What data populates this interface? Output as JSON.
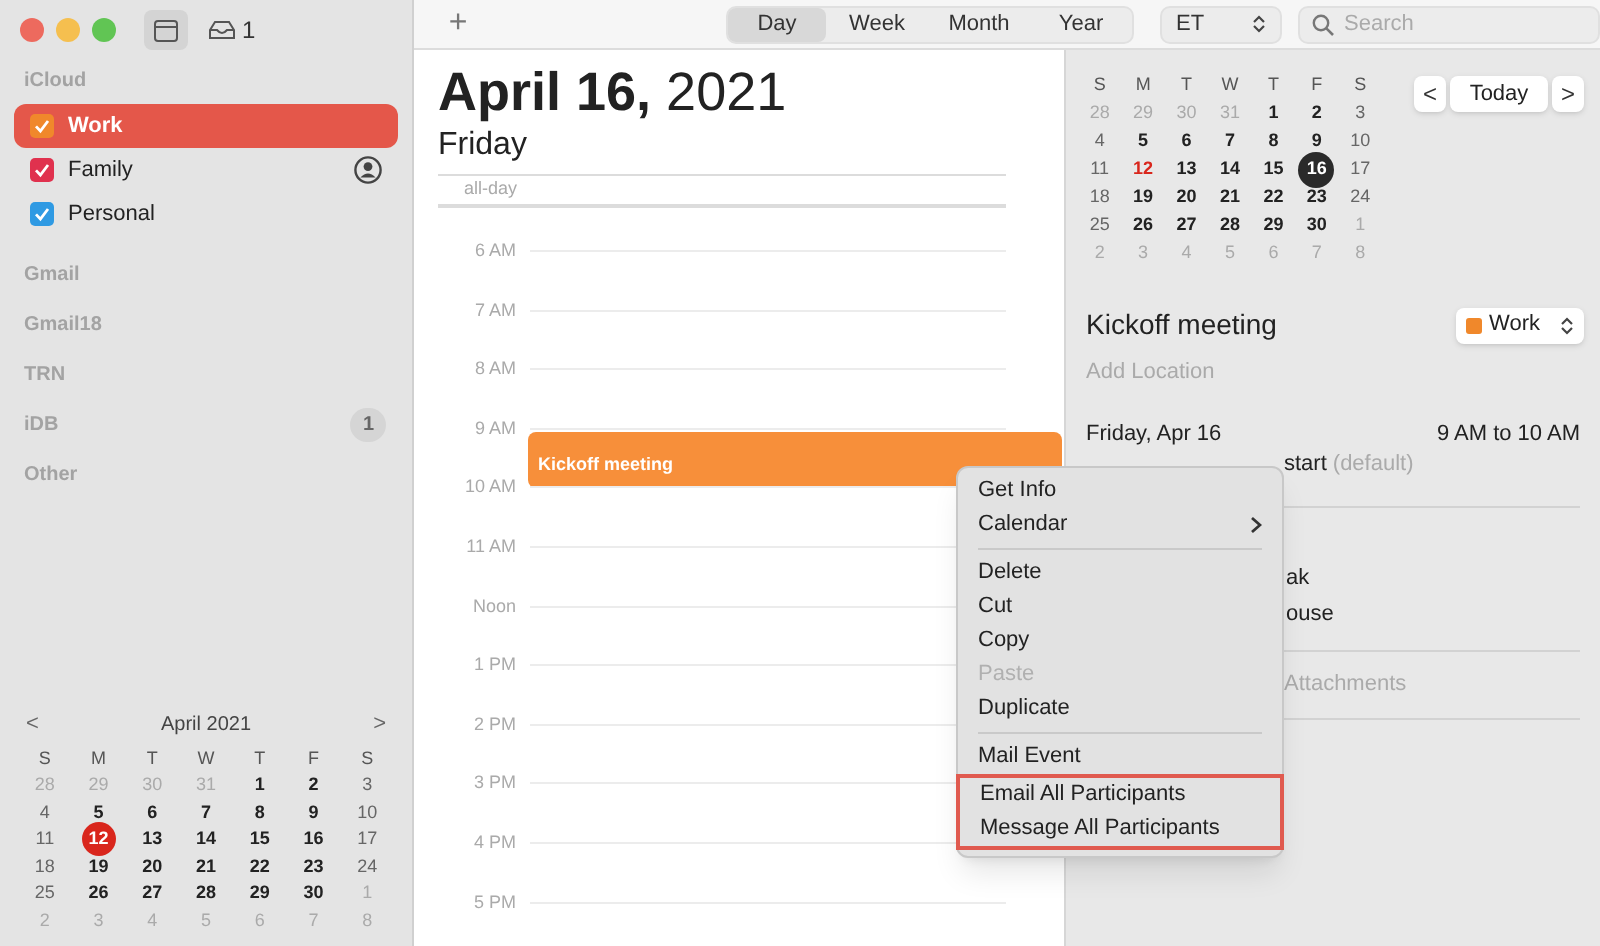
{
  "toolbar": {
    "inbox_count": "1",
    "add": "+",
    "view_tabs": [
      {
        "label": "Day",
        "selected": true
      },
      {
        "label": "Week",
        "selected": false
      },
      {
        "label": "Month",
        "selected": false
      },
      {
        "label": "Year",
        "selected": false
      }
    ],
    "timezone": "ET",
    "search": {
      "placeholder": "Search"
    }
  },
  "sidebar": {
    "accounts": [
      {
        "name": "iCloud",
        "calendars": [
          {
            "name": "Work",
            "color": "#f0882b",
            "checked": true,
            "selected": true,
            "shared": false
          },
          {
            "name": "Family",
            "color": "#e0314e",
            "checked": true,
            "selected": false,
            "shared": true
          },
          {
            "name": "Personal",
            "color": "#2f9ae3",
            "checked": true,
            "selected": false,
            "shared": false
          }
        ]
      },
      {
        "name": "Gmail"
      },
      {
        "name": "Gmail18"
      },
      {
        "name": "TRN"
      },
      {
        "name": "iDB",
        "badge": "1"
      },
      {
        "name": "Other"
      }
    ],
    "mini_calendar": {
      "prev": "<",
      "title": "April 2021",
      "next": ">",
      "weekdays": [
        "S",
        "M",
        "T",
        "W",
        "T",
        "F",
        "S"
      ],
      "weeks": [
        [
          {
            "day": "28",
            "kind": "other"
          },
          {
            "day": "29",
            "kind": "other"
          },
          {
            "day": "30",
            "kind": "other"
          },
          {
            "day": "31",
            "kind": "other"
          },
          {
            "day": "1",
            "kind": "day"
          },
          {
            "day": "2",
            "kind": "day"
          },
          {
            "day": "3",
            "kind": "weekend"
          }
        ],
        [
          {
            "day": "4",
            "kind": "weekend"
          },
          {
            "day": "5",
            "kind": "day"
          },
          {
            "day": "6",
            "kind": "day"
          },
          {
            "day": "7",
            "kind": "day"
          },
          {
            "day": "8",
            "kind": "day"
          },
          {
            "day": "9",
            "kind": "day"
          },
          {
            "day": "10",
            "kind": "weekend"
          }
        ],
        [
          {
            "day": "11",
            "kind": "weekend"
          },
          {
            "day": "12",
            "kind": "today"
          },
          {
            "day": "13",
            "kind": "day"
          },
          {
            "day": "14",
            "kind": "day"
          },
          {
            "day": "15",
            "kind": "day"
          },
          {
            "day": "16",
            "kind": "day"
          },
          {
            "day": "17",
            "kind": "weekend"
          }
        ],
        [
          {
            "day": "18",
            "kind": "weekend"
          },
          {
            "day": "19",
            "kind": "day"
          },
          {
            "day": "20",
            "kind": "day"
          },
          {
            "day": "21",
            "kind": "day"
          },
          {
            "day": "22",
            "kind": "day"
          },
          {
            "day": "23",
            "kind": "day"
          },
          {
            "day": "24",
            "kind": "weekend"
          }
        ],
        [
          {
            "day": "25",
            "kind": "weekend"
          },
          {
            "day": "26",
            "kind": "day"
          },
          {
            "day": "27",
            "kind": "day"
          },
          {
            "day": "28",
            "kind": "day"
          },
          {
            "day": "29",
            "kind": "day"
          },
          {
            "day": "30",
            "kind": "day"
          },
          {
            "day": "1",
            "kind": "other"
          }
        ],
        [
          {
            "day": "2",
            "kind": "other"
          },
          {
            "day": "3",
            "kind": "other"
          },
          {
            "day": "4",
            "kind": "other"
          },
          {
            "day": "5",
            "kind": "other"
          },
          {
            "day": "6",
            "kind": "other"
          },
          {
            "day": "7",
            "kind": "other"
          },
          {
            "day": "8",
            "kind": "other"
          }
        ]
      ]
    }
  },
  "day_view": {
    "title": "**April 16,** 2021",
    "weekday": "Friday",
    "all_day": "all-day",
    "hours": [
      {
        "label": "6 AM"
      },
      {
        "label": "7 AM"
      },
      {
        "label": "8 AM"
      },
      {
        "label": "9 AM",
        "event": "Kickoff meeting"
      },
      {
        "label": "10 AM"
      },
      {
        "label": "11 AM"
      },
      {
        "label": "Noon"
      },
      {
        "label": "1 PM"
      },
      {
        "label": "2 PM"
      },
      {
        "label": "3 PM"
      },
      {
        "label": "4 PM"
      },
      {
        "label": "5 PM"
      }
    ]
  },
  "inspector": {
    "calendar": {
      "weekdays": [
        "S",
        "M",
        "T",
        "W",
        "T",
        "F",
        "S"
      ],
      "weeks": [
        [
          {
            "day": "28",
            "kind": "other"
          },
          {
            "day": "29",
            "kind": "other"
          },
          {
            "day": "30",
            "kind": "other"
          },
          {
            "day": "31",
            "kind": "other"
          },
          {
            "day": "1",
            "kind": "day"
          },
          {
            "day": "2",
            "kind": "day"
          },
          {
            "day": "3",
            "kind": "weekend"
          }
        ],
        [
          {
            "day": "4",
            "kind": "weekend"
          },
          {
            "day": "5",
            "kind": "day"
          },
          {
            "day": "6",
            "kind": "day"
          },
          {
            "day": "7",
            "kind": "day"
          },
          {
            "day": "8",
            "kind": "day"
          },
          {
            "day": "9",
            "kind": "day"
          },
          {
            "day": "10",
            "kind": "weekend"
          }
        ],
        [
          {
            "day": "11",
            "kind": "weekend"
          },
          {
            "day": "12",
            "kind": "today"
          },
          {
            "day": "13",
            "kind": "day"
          },
          {
            "day": "14",
            "kind": "day"
          },
          {
            "day": "15",
            "kind": "day"
          },
          {
            "day": "16",
            "kind": "selected"
          },
          {
            "day": "17",
            "kind": "weekend"
          }
        ],
        [
          {
            "day": "18",
            "kind": "weekend"
          },
          {
            "day": "19",
            "kind": "day"
          },
          {
            "day": "20",
            "kind": "day"
          },
          {
            "day": "21",
            "kind": "day"
          },
          {
            "day": "22",
            "kind": "day"
          },
          {
            "day": "23",
            "kind": "day"
          },
          {
            "day": "24",
            "kind": "weekend"
          }
        ],
        [
          {
            "day": "25",
            "kind": "weekend"
          },
          {
            "day": "26",
            "kind": "day"
          },
          {
            "day": "27",
            "kind": "day"
          },
          {
            "day": "28",
            "kind": "day"
          },
          {
            "day": "29",
            "kind": "day"
          },
          {
            "day": "30",
            "kind": "day"
          },
          {
            "day": "1",
            "kind": "other"
          }
        ],
        [
          {
            "day": "2",
            "kind": "other"
          },
          {
            "day": "3",
            "kind": "other"
          },
          {
            "day": "4",
            "kind": "other"
          },
          {
            "day": "5",
            "kind": "other"
          },
          {
            "day": "6",
            "kind": "other"
          },
          {
            "day": "7",
            "kind": "other"
          },
          {
            "day": "8",
            "kind": "other"
          }
        ]
      ]
    },
    "prev": "<",
    "today": "Today",
    "next": ">",
    "event_title": "Kickoff meeting",
    "calendar_popup": {
      "label": "Work",
      "color": "#f0882b"
    },
    "location": {
      "placeholder": "Add Location"
    },
    "date": "Friday, Apr 16",
    "time": "9 AM to 10 AM",
    "alert": "start",
    "alert_note": "(default)",
    "partial_1": "ak",
    "partial_2": "ouse",
    "attachments": "Attachments"
  },
  "context_menu": {
    "items": [
      {
        "kind": "item",
        "label": "Get Info",
        "disabled": false,
        "submenu": false,
        "highlighted": false
      },
      {
        "kind": "item",
        "label": "Calendar",
        "disabled": false,
        "submenu": true,
        "highlighted": false
      },
      {
        "kind": "separator"
      },
      {
        "kind": "item",
        "label": "Delete",
        "disabled": false,
        "submenu": false,
        "highlighted": false
      },
      {
        "kind": "item",
        "label": "Cut",
        "disabled": false,
        "submenu": false,
        "highlighted": false
      },
      {
        "kind": "item",
        "label": "Copy",
        "disabled": false,
        "submenu": false,
        "highlighted": false
      },
      {
        "kind": "item",
        "label": "Paste",
        "disabled": true,
        "submenu": false,
        "highlighted": false
      },
      {
        "kind": "item",
        "label": "Duplicate",
        "disabled": false,
        "submenu": false,
        "highlighted": false
      },
      {
        "kind": "separator"
      },
      {
        "kind": "item",
        "label": "Mail Event",
        "disabled": false,
        "submenu": false,
        "highlighted": false
      },
      {
        "kind": "item",
        "label": "Email All Participants",
        "disabled": false,
        "submenu": false,
        "highlighted": true
      },
      {
        "kind": "item",
        "label": "Message All Participants",
        "disabled": false,
        "submenu": false,
        "highlighted": true
      }
    ]
  }
}
